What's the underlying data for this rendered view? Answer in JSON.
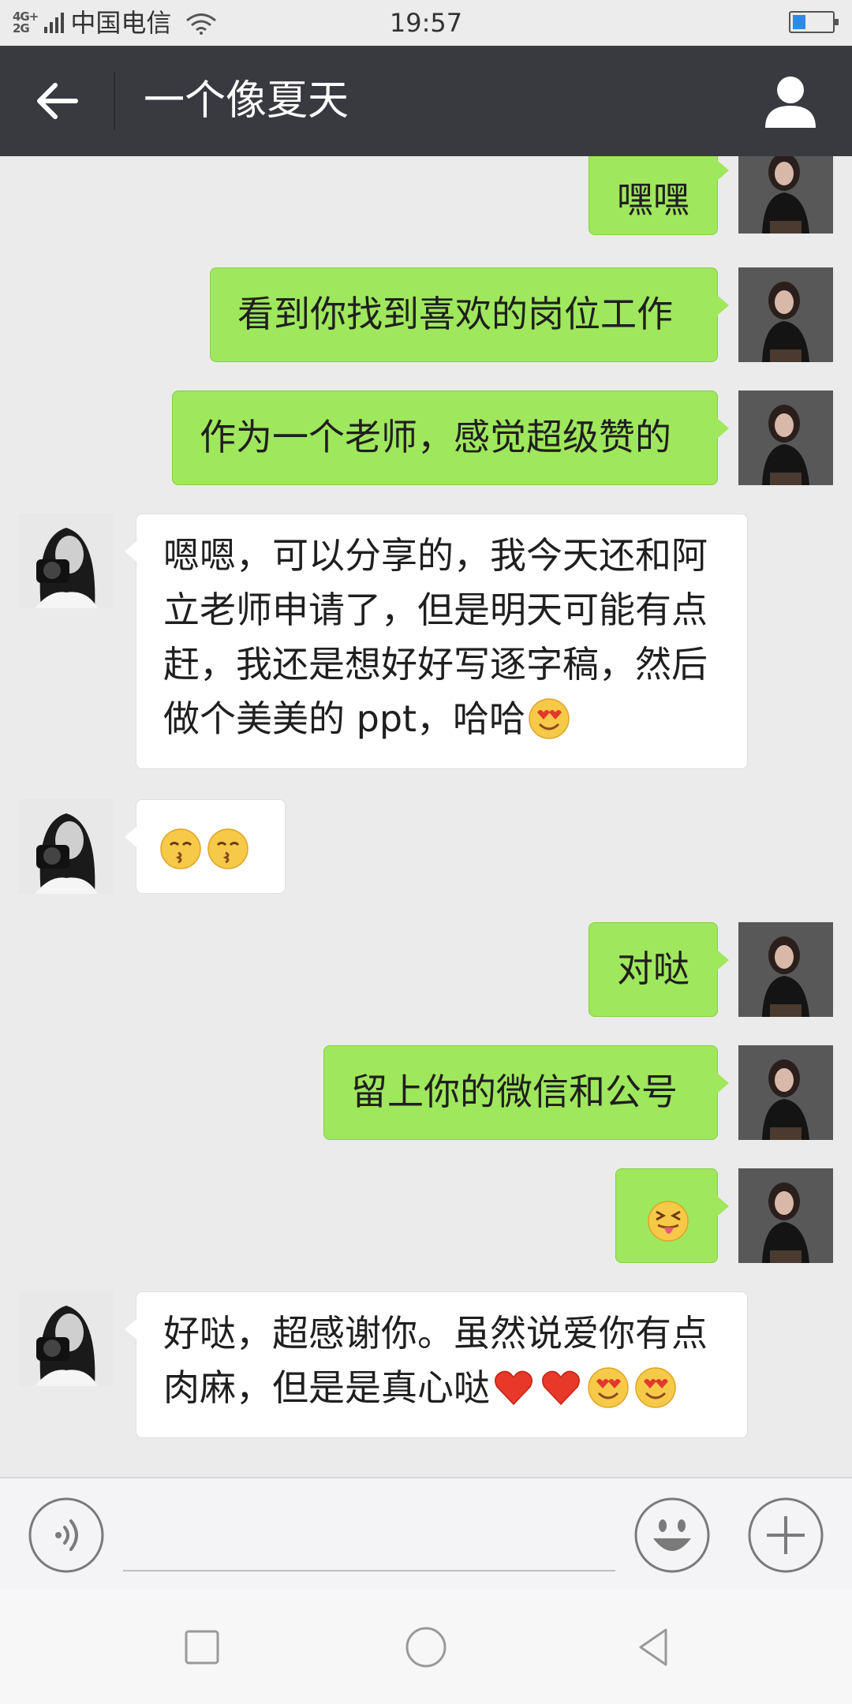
{
  "status_bar": {
    "network_top": "4G+",
    "network_bottom": "2G",
    "carrier": "中国电信",
    "time": "19:57"
  },
  "header": {
    "title": "一个像夏天"
  },
  "messages": [
    {
      "side": "out",
      "text": "嘿嘿"
    },
    {
      "side": "out",
      "text": "看到你找到喜欢的岗位工作"
    },
    {
      "side": "out",
      "text": "作为一个老师，感觉超级赞的"
    },
    {
      "side": "in",
      "lines": [
        "嗯嗯，可以分享的，我今天还和阿",
        "立老师申请了，但是明天可能有点",
        "赶，我还是想好好写逐字稿，然后",
        "做个美美的 ppt，哈哈"
      ],
      "emoji": [
        "heart-eyes"
      ]
    },
    {
      "side": "in",
      "emoji": [
        "kissing",
        "kissing"
      ]
    },
    {
      "side": "out",
      "text": "对哒"
    },
    {
      "side": "out",
      "text": "留上你的微信和公号"
    },
    {
      "side": "out",
      "emoji": [
        "tongue-wink"
      ]
    },
    {
      "side": "in",
      "lines": [
        "好哒，超感谢你。虽然说爱你有点",
        "肉麻，但是是真心哒"
      ],
      "emoji": [
        "red-heart",
        "red-heart",
        "heart-eyes",
        "heart-eyes"
      ]
    }
  ],
  "input_bar": {
    "text_value": "",
    "icons": [
      "voice-icon",
      "emoji-icon",
      "plus-icon"
    ]
  },
  "system_nav": {
    "icons": [
      "recent-apps-icon",
      "home-icon",
      "back-icon"
    ]
  },
  "colors": {
    "nav_bg": "#393a3f",
    "chat_bg": "#ebebeb",
    "outgoing_bubble": "#9fe75c",
    "incoming_bubble": "#ffffff"
  }
}
